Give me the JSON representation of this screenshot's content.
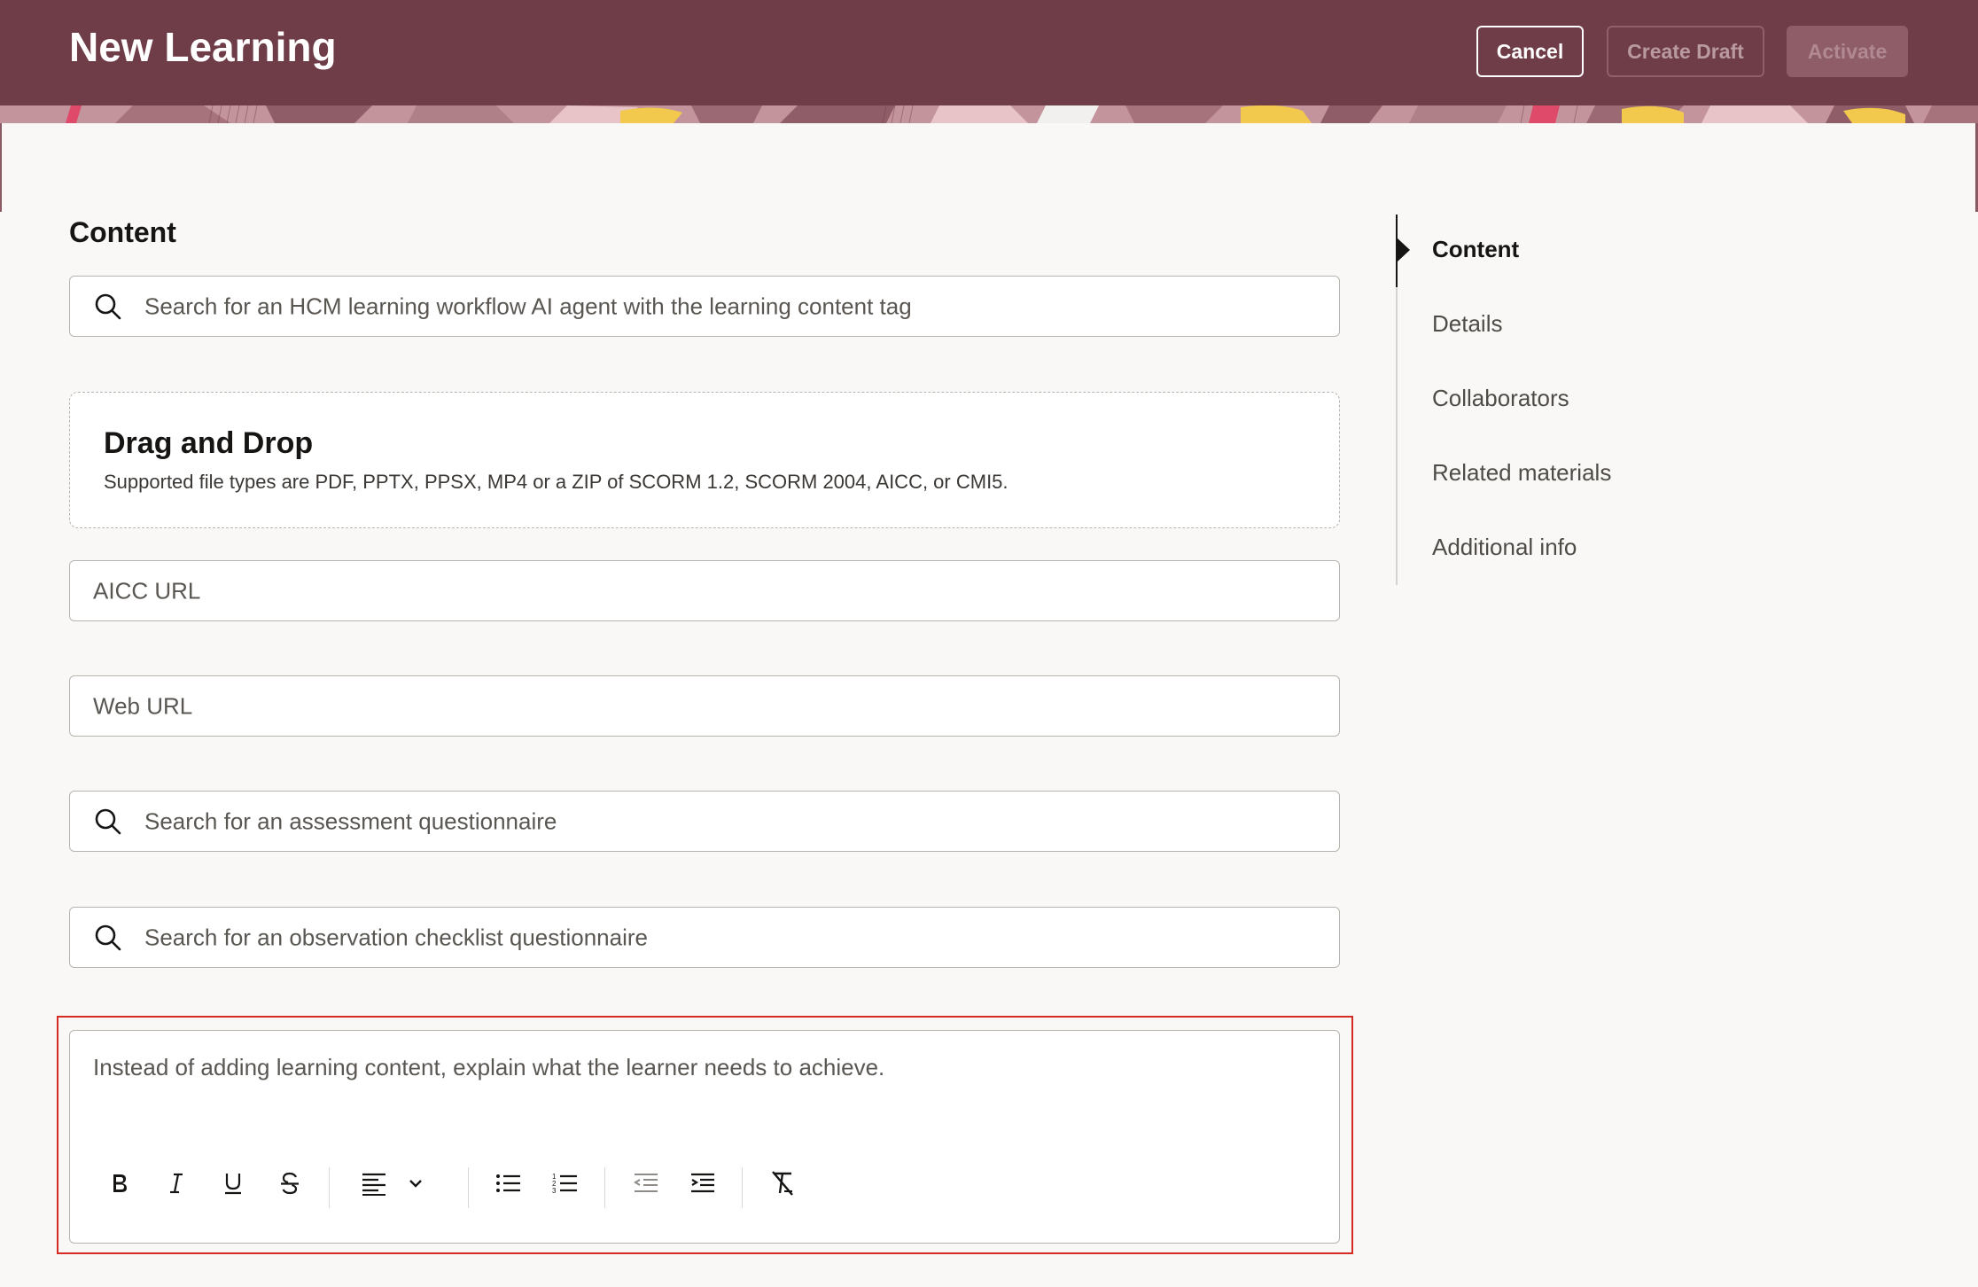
{
  "header": {
    "title": "New Learning",
    "cancel_label": "Cancel",
    "create_draft_label": "Create Draft",
    "activate_label": "Activate",
    "background_color": "#6f3d48"
  },
  "content": {
    "section_title": "Content",
    "agent_search_placeholder": "Search for an HCM learning workflow AI agent with the learning content tag",
    "dropzone": {
      "title": "Drag and Drop",
      "subtitle": "Supported file types are PDF, PPTX, PPSX, MP4 or a ZIP of SCORM 1.2, SCORM 2004, AICC, or CMI5."
    },
    "aicc_url_placeholder": "AICC URL",
    "web_url_placeholder": "Web URL",
    "assessment_search_placeholder": "Search for an assessment questionnaire",
    "observation_search_placeholder": "Search for an observation checklist questionnaire",
    "editor_placeholder": "Instead of adding learning content, explain what the learner needs to achieve.",
    "editor_toolbar": [
      "bold-icon",
      "italic-icon",
      "underline-icon",
      "strikethrough-icon",
      "align-left-icon",
      "chevron-down-icon",
      "bulleted-list-icon",
      "numbered-list-icon",
      "outdent-icon",
      "indent-icon",
      "clear-formatting-icon"
    ],
    "highlight_color": "#d62a24"
  },
  "nav": {
    "items": [
      {
        "label": "Content",
        "active": true
      },
      {
        "label": "Details"
      },
      {
        "label": "Collaborators"
      },
      {
        "label": "Related materials"
      },
      {
        "label": "Additional info"
      }
    ]
  }
}
